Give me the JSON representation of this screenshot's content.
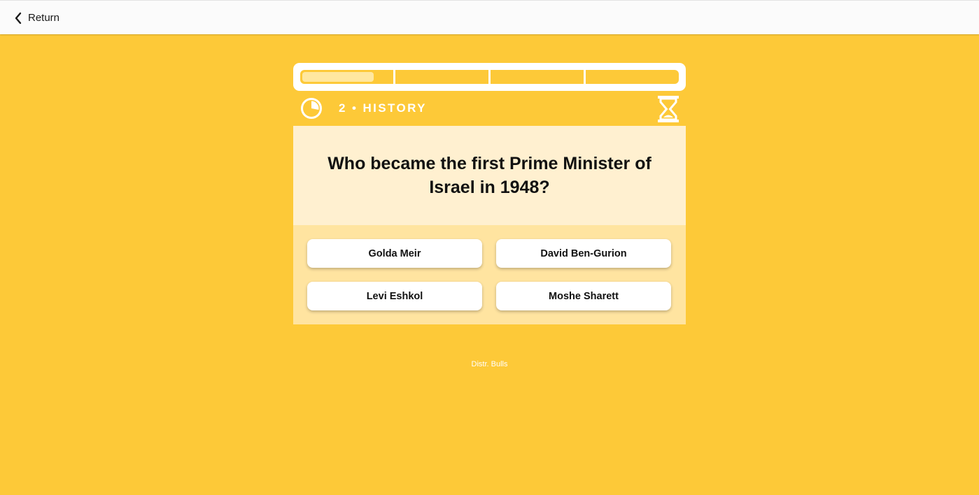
{
  "header": {
    "return_label": "Return",
    "back_icon": "chevron-left-icon"
  },
  "quiz": {
    "progress": {
      "segments": 4,
      "current_segment": 1,
      "current_segment_fraction": 0.8,
      "track_color": "#fdc938",
      "fill_color": "#ffe7a0"
    },
    "question_number": "2",
    "separator": "•",
    "category": "HISTORY",
    "timer_icon": "pie-timer-icon",
    "hourglass_icon": "hourglass-icon",
    "question": "Who became the first Prime Minister of Israel in 1948?",
    "answers": [
      {
        "label": "Golda Meir"
      },
      {
        "label": "David Ben-Gurion"
      },
      {
        "label": "Levi Eshkol"
      },
      {
        "label": "Moshe Sharett"
      }
    ]
  },
  "footer": {
    "credit": "Distr. Bulls"
  },
  "colors": {
    "background": "#fdc938",
    "question_card": "#fff0d0",
    "answers_panel": "#ffe4a0",
    "header_bar": "#fbfbfb"
  }
}
